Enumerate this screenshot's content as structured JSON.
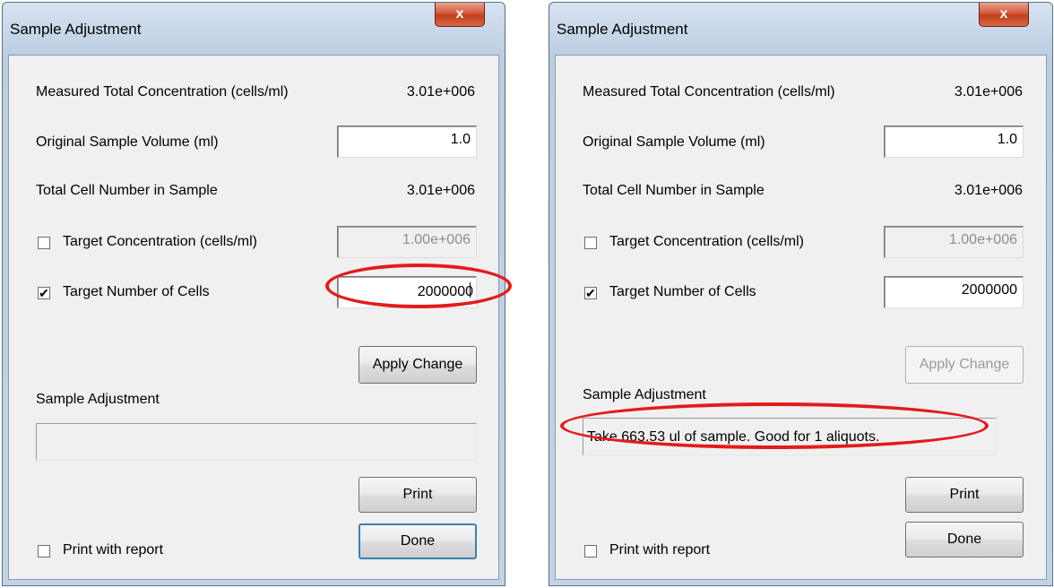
{
  "left": {
    "title": "Sample Adjustment",
    "close_label": "x",
    "measured_label": "Measured Total Concentration (cells/ml)",
    "measured_value": "3.01e+006",
    "volume_label": "Original Sample Volume (ml)",
    "volume_value": "1.0",
    "total_label": "Total Cell Number in Sample",
    "total_value": "3.01e+006",
    "target_conc_checked": false,
    "target_conc_label": "Target Concentration (cells/ml)",
    "target_conc_value": "1.00e+006",
    "target_num_checked": true,
    "target_num_label": "Target Number of Cells",
    "target_num_value": "2000000",
    "apply_label": "Apply Change",
    "adjust_label": "Sample Adjustment",
    "adjust_output": "",
    "print_label": "Print",
    "done_label": "Done",
    "print_report_checked": false,
    "print_report_label": "Print with report",
    "check_mark": "✔"
  },
  "right": {
    "title": "Sample Adjustment",
    "close_label": "x",
    "measured_label": "Measured Total Concentration (cells/ml)",
    "measured_value": "3.01e+006",
    "volume_label": "Original Sample Volume (ml)",
    "volume_value": "1.0",
    "total_label": "Total Cell Number in Sample",
    "total_value": "3.01e+006",
    "target_conc_checked": false,
    "target_conc_label": "Target Concentration (cells/ml)",
    "target_conc_value": "1.00e+006",
    "target_num_checked": true,
    "target_num_label": "Target Number of Cells",
    "target_num_value": "2000000",
    "apply_label": "Apply Change",
    "adjust_label": "Sample Adjustment",
    "adjust_output": "Take 663.53 ul of sample. Good for 1 aliquots.",
    "print_label": "Print",
    "done_label": "Done",
    "print_report_checked": false,
    "print_report_label": "Print with report",
    "check_mark": "✔"
  },
  "colors": {
    "highlight_ring": "#e31b1b",
    "close_button": "#c03e1e",
    "dialog_frame": "#c3d3e6"
  }
}
